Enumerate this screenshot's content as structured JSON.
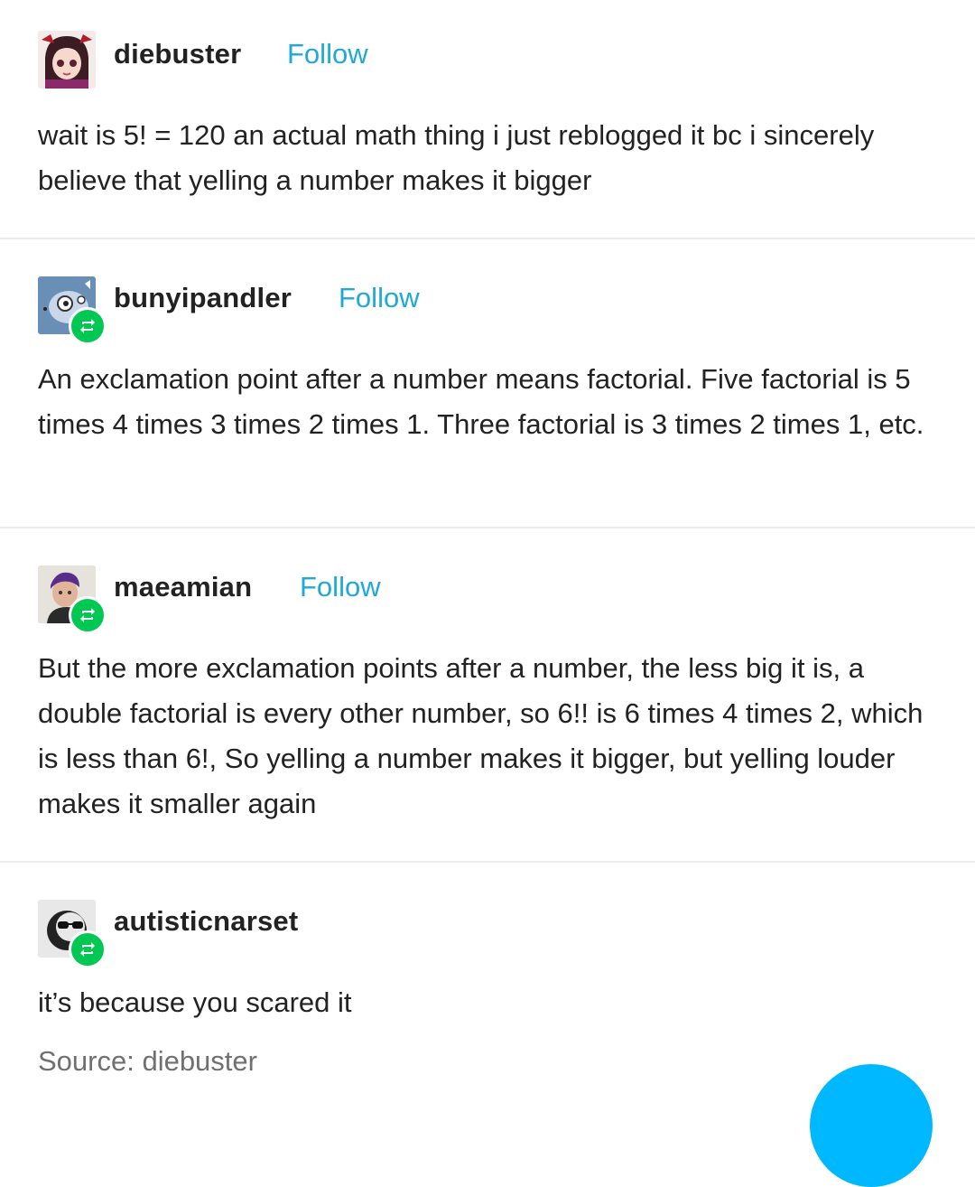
{
  "posts": [
    {
      "username": "diebuster",
      "follow_label": "Follow",
      "avatar_icon": "anime-girl-avatar-icon",
      "text": "wait is 5! = 120 an actual math thing i just reblogged it bc i sincerely believe that yelling a number makes it bigger"
    },
    {
      "username": "bunyipandler",
      "follow_label": "Follow",
      "avatar_icon": "cartoon-creature-avatar-icon",
      "text": "An exclamation point after a number means factorial. Five factorial is 5 times 4 times 3 times 2 times 1. Three factorial is 3 times 2 times 1, etc."
    },
    {
      "username": "maeamian",
      "follow_label": "Follow",
      "avatar_icon": "person-photo-avatar-icon",
      "text": "But the more exclamation points after a number, the less big it is, a double factorial is every other number, so 6!! is 6 times 4 times 2, which is less than 6!, So yelling a number makes it bigger, but yelling louder makes it smaller again"
    },
    {
      "username": "autisticnarset",
      "avatar_icon": "sunglasses-character-avatar-icon",
      "text": "it’s because you scared it"
    }
  ],
  "source_text": "Source: diebuster",
  "icons": {
    "reblog": "reblog-icon"
  },
  "colors": {
    "follow": "#1fa9d6",
    "reblog_badge": "#00c853",
    "source": "#707070",
    "blue_circle": "#00b8ff"
  }
}
